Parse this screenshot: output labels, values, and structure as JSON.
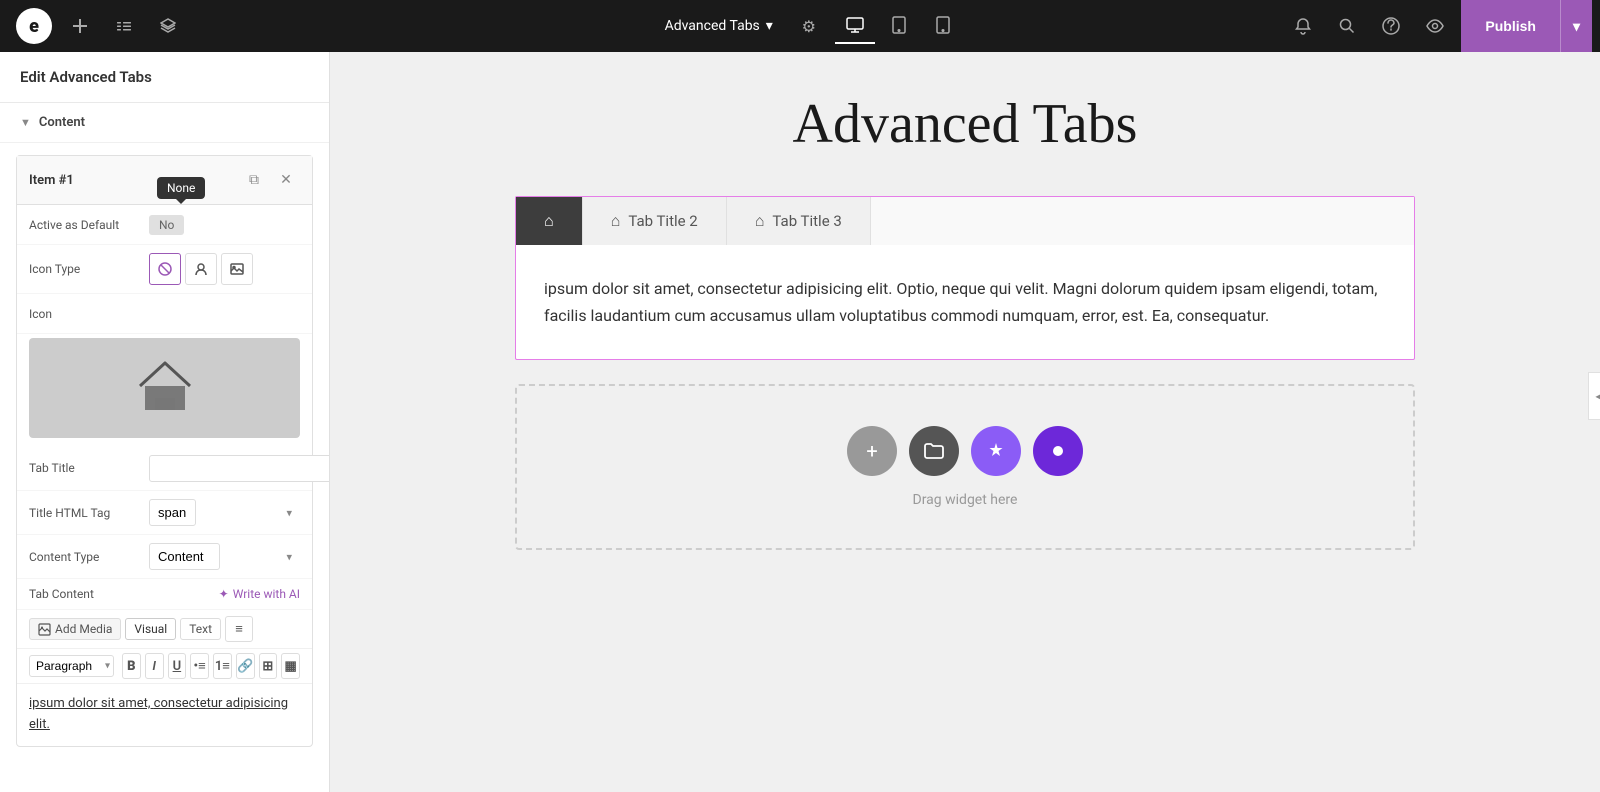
{
  "topbar": {
    "logo_text": "e",
    "page_title": "Advanced Tabs",
    "settings_icon": "⚙",
    "publish_label": "Publish",
    "publish_arrow": "▾"
  },
  "left_panel": {
    "header_title": "Edit Advanced Tabs",
    "section_label": "Content",
    "item_title": "Item #1",
    "active_as_default_label": "Active as Default",
    "active_as_default_value": "No",
    "none_tooltip": "None",
    "icon_type_label": "Icon Type",
    "icon_label": "Icon",
    "tab_title_label": "Tab Title",
    "tab_title_value": "",
    "title_html_tag_label": "Title HTML Tag",
    "title_html_tag_value": "span",
    "content_type_label": "Content Type",
    "content_type_value": "Content",
    "tab_content_label": "Tab Content",
    "write_ai_label": "✦ Write with AI",
    "add_media_label": "Add Media",
    "visual_tab_label": "Visual",
    "text_tab_label": "Text",
    "paragraph_format": "Paragraph",
    "editor_content": "ipsum dolor sit amet, consectetur adipisicing elit."
  },
  "canvas": {
    "page_title": "Advanced Tabs",
    "tab1_icon": "⌂",
    "tab2_label": "Tab Title 2",
    "tab2_icon": "⌂",
    "tab3_label": "Tab Title 3",
    "tab3_icon": "⌂",
    "content_text": "ipsum dolor sit amet, consectetur adipisicing elit. Optio, neque qui velit. Magni dolorum quidem ipsam eligendi, totam, facilis laudantium cum accusamus ullam voluptatibus commodi numquam, error, est. Ea, consequatur.",
    "drag_widget_text": "Drag widget here"
  }
}
